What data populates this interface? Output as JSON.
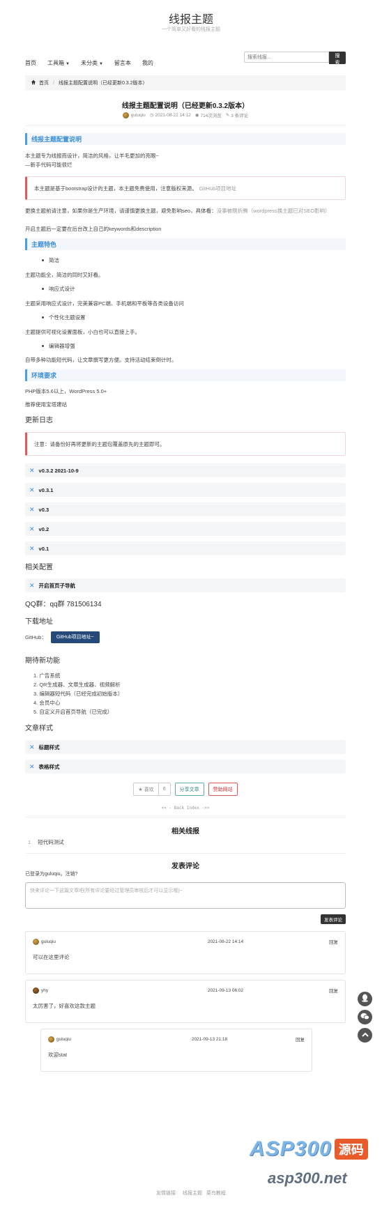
{
  "site": {
    "title": "线报主题",
    "subtitle": "一个简单又好看的线报主题"
  },
  "nav": {
    "items": [
      "首页",
      "工具箱",
      "未分类",
      "留言本",
      "我的"
    ],
    "search_placeholder": "搜索线报...",
    "search_button": "搜索"
  },
  "breadcrumb": {
    "home": "首页",
    "current": "线报主题配置说明（已经更新0.3.2版本）"
  },
  "post": {
    "title": "线报主题配置说明（已经更新0.3.2版本）",
    "author": "guluqiu",
    "date": "2021-08-22 14:12",
    "views": "714次浏览",
    "comments": "3 条评论"
  },
  "content": {
    "h_config": "线报主题配置说明",
    "intro1": "本主题专为线报而设计，简洁的风格，让羊毛更加的亮眼~",
    "intro2": "—新手代码可能很烂",
    "note1": "本主题是基于bootstrap设计的主题，本主题免费使用，注意版权来源。",
    "note1_link": "GitHub项目地址",
    "warn1a": "更换主题前请注意，如果你是生产环境，请谨慎更换主题，避免影响seo，具体看：",
    "warn1_link": "没事被瞎折腾（wordpress换主题已对SEO影响）",
    "warn2": "开启主题后一定要在后台改上自己的keywords和description",
    "h_feature": "主题特色",
    "f1": "简洁",
    "f1d": "主题功能全，简洁的同时又好看。",
    "f2": "响应式设计",
    "f2d": "主题采用响应式设计，完美兼容PC端、手机端和平板等各类设备访问",
    "f3": "个性化主题设置",
    "f3d": "主题提供可视化设置面板，小白也可以直接上手。",
    "f4": "编辑器增强",
    "f4d": "自带多种功能短代码，让文章撰写更方便。支持活动结束倒计时。",
    "h_env": "环境要求",
    "env1": "PHP版本5.6以上，WordPress 5.0+",
    "env2": "推荐使用宝塔建站",
    "h_changelog": "更新日志",
    "note2": "注意：请备份好再将更新的主题包覆盖原先的主题即可。",
    "versions": [
      "v0.3.2 2021-10-9",
      "v0.3.1",
      "v0.3",
      "v0.2",
      "v0.1"
    ],
    "h_related_conf": "相关配置",
    "related_conf_item": "开启首页子导航",
    "qq": "QQ群：qq群 781506134",
    "h_download": "下载地址",
    "github_label": "GitHub：",
    "github_btn": "GitHub项目地址~",
    "h_future": "期待新功能",
    "future": [
      "广告系统",
      "QR生成器、文章生成器、视频解析",
      "编辑器短代码（已经完成初始版本）",
      "会员中心",
      "自定义开启首页导航（已完成）"
    ],
    "h_style": "文章样式",
    "style_items": [
      "标题样式",
      "表格样式"
    ]
  },
  "actions": {
    "like": "喜欢",
    "like_count": "6",
    "share": "分享文章",
    "sponsor": "赞助网站"
  },
  "back_index": "<< - Back Index ->>",
  "related": {
    "title": "相关线报",
    "items": [
      {
        "num": "1",
        "title": "短代码测试"
      }
    ]
  },
  "comment_form": {
    "title": "发表评论",
    "logged_in": "已登录为guluqiu。注销?",
    "placeholder": "快来评论一下这篇文章吧(所有评论要经过管理员审核后才可以显示哦)~",
    "submit": "发表评论"
  },
  "comments": [
    {
      "name": "guluqiu",
      "time": "2021-08-22 14:14",
      "reply": "回复",
      "text": "可以在这里评论"
    },
    {
      "name": "yhy",
      "time": "2021-09-13 06:02",
      "reply": "回复",
      "text": "太厉害了，好喜欢这款主题"
    },
    {
      "name": "guluqiu",
      "time": "2021-09-13 21:18",
      "reply": "回复",
      "text": "欢迎stat"
    }
  ],
  "footer": {
    "label": "友情链接:",
    "links": [
      "线报主题",
      "菜鸟教程"
    ]
  },
  "watermark": {
    "brand": "ASP300",
    "tag": "源码",
    "domain": "asp300.net"
  }
}
